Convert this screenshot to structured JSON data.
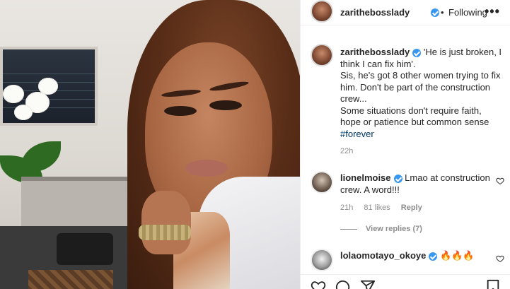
{
  "header": {
    "username": "zarithebosslady",
    "separator": "•",
    "follow_status": "Following",
    "more_label": "•••"
  },
  "caption": {
    "username": "zarithebosslady",
    "line1": "'He is just broken, I think I can fix him'.",
    "line2": "Sis, he's got 8 other women trying to fix him. Don't be part of the construction crew...",
    "line3": "Some situations don't require faith, hope or patience but common sense",
    "hashtag": "#forever",
    "time": "22h"
  },
  "comments": [
    {
      "username": "lionelmoise",
      "text": "Lmao at construction crew. A word!!!",
      "time": "21h",
      "likes": "81 likes",
      "reply_label": "Reply",
      "view_replies": "View replies (7)"
    },
    {
      "username": "lolaomotayo_okoye",
      "text": "🔥🔥🔥"
    }
  ],
  "icons": {
    "verified": "verified-badge-icon",
    "heart": "heart-icon",
    "comment": "comment-icon",
    "share": "share-icon",
    "bookmark": "bookmark-icon"
  },
  "colors": {
    "verified": "#3897f0",
    "hashtag": "#00376b",
    "muted": "#8e8e8e",
    "text": "#262626"
  }
}
